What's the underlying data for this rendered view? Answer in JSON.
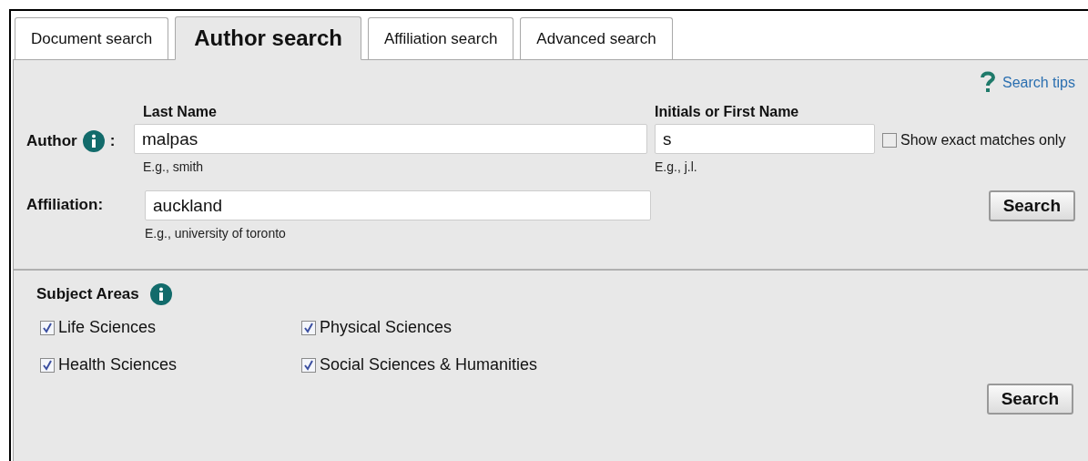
{
  "tabs": [
    {
      "label": "Document search",
      "selected": false
    },
    {
      "label": "Author search",
      "selected": true
    },
    {
      "label": "Affiliation search",
      "selected": false
    },
    {
      "label": "Advanced search",
      "selected": false
    }
  ],
  "search_tips": "Search tips",
  "author": {
    "label": "Author",
    "colon": ":",
    "last_name": {
      "label": "Last Name",
      "value": "malpas",
      "hint": "E.g., smith"
    },
    "first_name": {
      "label": "Initials or First Name",
      "value": "s",
      "hint": "E.g., j.l."
    },
    "exact_matches": {
      "label": "Show exact matches only",
      "checked": false
    }
  },
  "affiliation": {
    "label": "Affiliation:",
    "value": "auckland",
    "hint": "E.g., university of toronto"
  },
  "search_button": "Search",
  "subject_areas": {
    "title": "Subject Areas",
    "items": [
      {
        "label": "Life Sciences",
        "checked": true
      },
      {
        "label": "Physical Sciences",
        "checked": true
      },
      {
        "label": "Health Sciences",
        "checked": true
      },
      {
        "label": "Social Sciences & Humanities",
        "checked": true
      }
    ]
  },
  "subject_search_button": "Search"
}
